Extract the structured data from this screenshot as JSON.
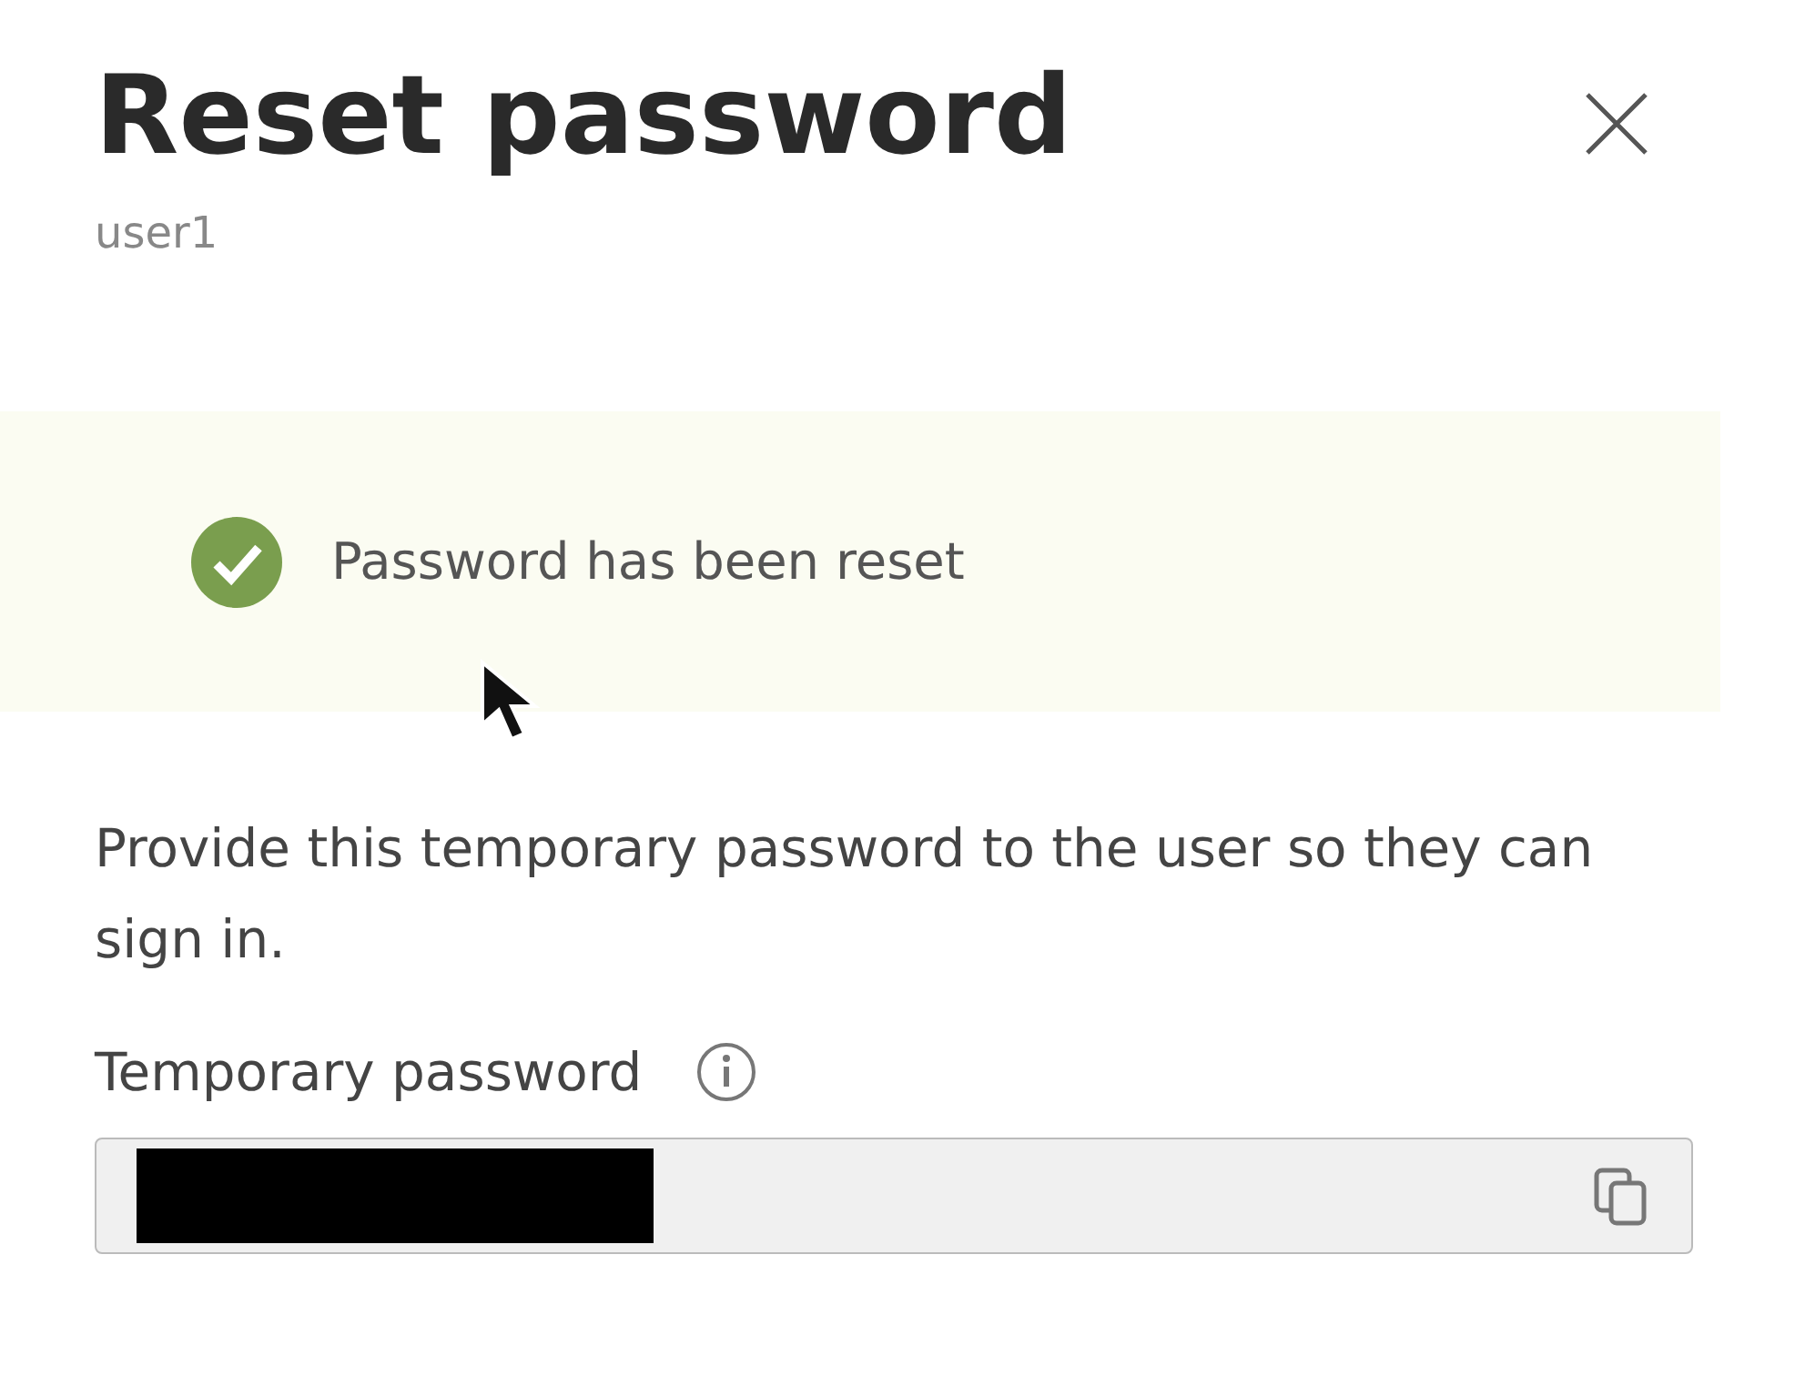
{
  "panel": {
    "title": "Reset password",
    "subtitle": "user1"
  },
  "banner": {
    "kind": "success",
    "message": "Password has been reset"
  },
  "instructions": "Provide this temporary password to the user so they can sign in.",
  "password_field": {
    "label": "Temporary password",
    "redacted": true
  }
}
